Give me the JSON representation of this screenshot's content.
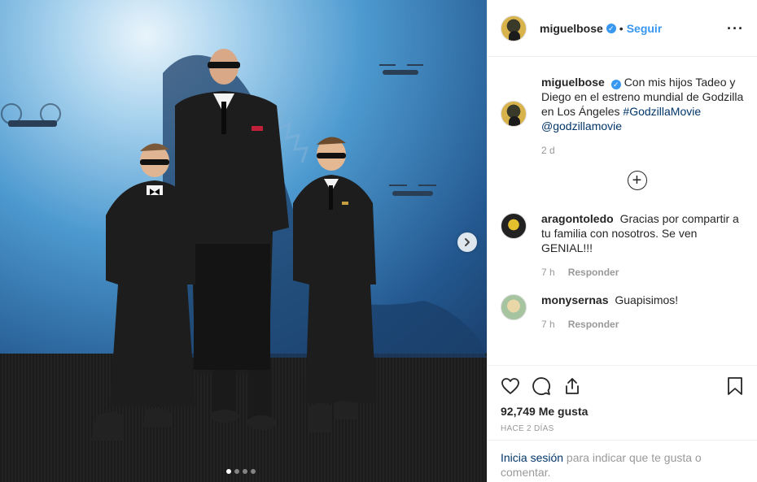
{
  "header": {
    "username": "miguelbose",
    "separator": "•",
    "follow_label": "Seguir",
    "more_label": "···"
  },
  "caption": {
    "username": "miguelbose",
    "text": "Con mis hijos Tadeo y Diego en el estreno mundial de Godzilla en Los Ángeles",
    "hashtag": "#GodzillaMovie",
    "mention": "@godzillamovie",
    "time": "2 d"
  },
  "load_more_label": "+",
  "comments": [
    {
      "username": "aragontoledo",
      "text": "Gracias por compartir a tu familia con nosotros. Se ven GENIAL!!!",
      "time": "7 h",
      "reply_label": "Responder"
    },
    {
      "username": "monysernas",
      "text": "Guapisimos!",
      "time": "7 h",
      "reply_label": "Responder"
    }
  ],
  "actions": {
    "likes": "92,749 Me gusta",
    "posted": "HACE 2 DÍAS"
  },
  "login": {
    "link": "Inicia sesión",
    "text": " para indicar que te gusta o comentar."
  },
  "carousel": {
    "slides": 4,
    "active_index": 0
  },
  "icons": [
    "verified-icon",
    "more-icon",
    "heart-icon",
    "comment-icon",
    "share-icon",
    "bookmark-icon",
    "chevron-right-icon",
    "plus-circle-icon"
  ],
  "colors": {
    "link": "#3897f0",
    "tag": "#003569",
    "muted": "#999999",
    "border": "#efefef"
  }
}
